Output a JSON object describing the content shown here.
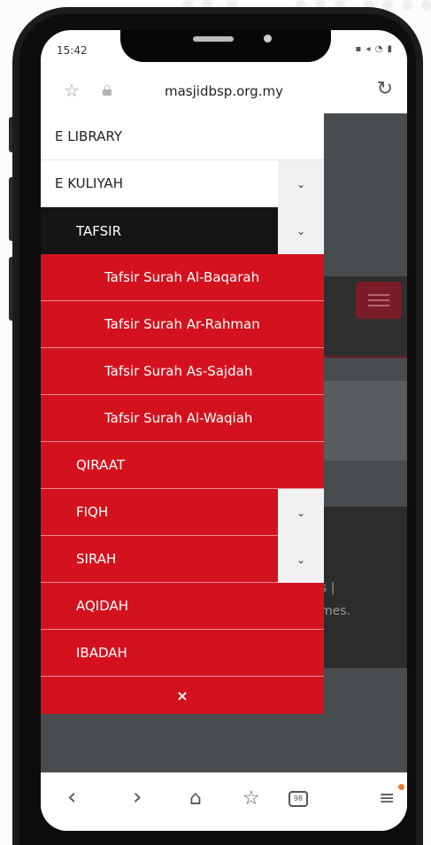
{
  "status_bar": {
    "time": "15:42",
    "icons": "▪ ◂ ◔ ▮"
  },
  "browser": {
    "url": "masjidbsp.org.my"
  },
  "page_behind": {
    "text_line_1": "s |",
    "text_line_2": "mes."
  },
  "menu": {
    "items": [
      {
        "label": "E LIBRARY",
        "style": "white",
        "has_toggle": false
      },
      {
        "label": "E KULIYAH",
        "style": "white",
        "has_toggle": true
      },
      {
        "label": "TAFSIR",
        "style": "black",
        "has_toggle": true
      },
      {
        "label": "Tafsir Surah Al-Baqarah",
        "style": "red-sub",
        "has_toggle": false
      },
      {
        "label": "Tafsir Surah Ar-Rahman",
        "style": "red-sub",
        "has_toggle": false
      },
      {
        "label": "Tafsir Surah As-Sajdah",
        "style": "red-sub",
        "has_toggle": false
      },
      {
        "label": "Tafsir Surah Al-Waqiah",
        "style": "red-sub",
        "has_toggle": false
      },
      {
        "label": "QIRAAT",
        "style": "red",
        "has_toggle": false
      },
      {
        "label": "FIQH",
        "style": "red",
        "has_toggle": true
      },
      {
        "label": "SIRAH",
        "style": "red",
        "has_toggle": true
      },
      {
        "label": "AQIDAH",
        "style": "red",
        "has_toggle": false
      },
      {
        "label": "IBADAH",
        "style": "red",
        "has_toggle": false
      }
    ],
    "close_label": "×",
    "toggle_glyph": "⌄"
  },
  "toolbar": {
    "back": "‹",
    "forward": "›",
    "home": "⌂",
    "bookmark": "☆",
    "tabs_count": "98",
    "menu": "≡"
  },
  "colors": {
    "menu_red": "#d4121e",
    "menu_black": "#151515",
    "page_bg": "#494c4f",
    "accent_dot": "#f07a2a"
  }
}
